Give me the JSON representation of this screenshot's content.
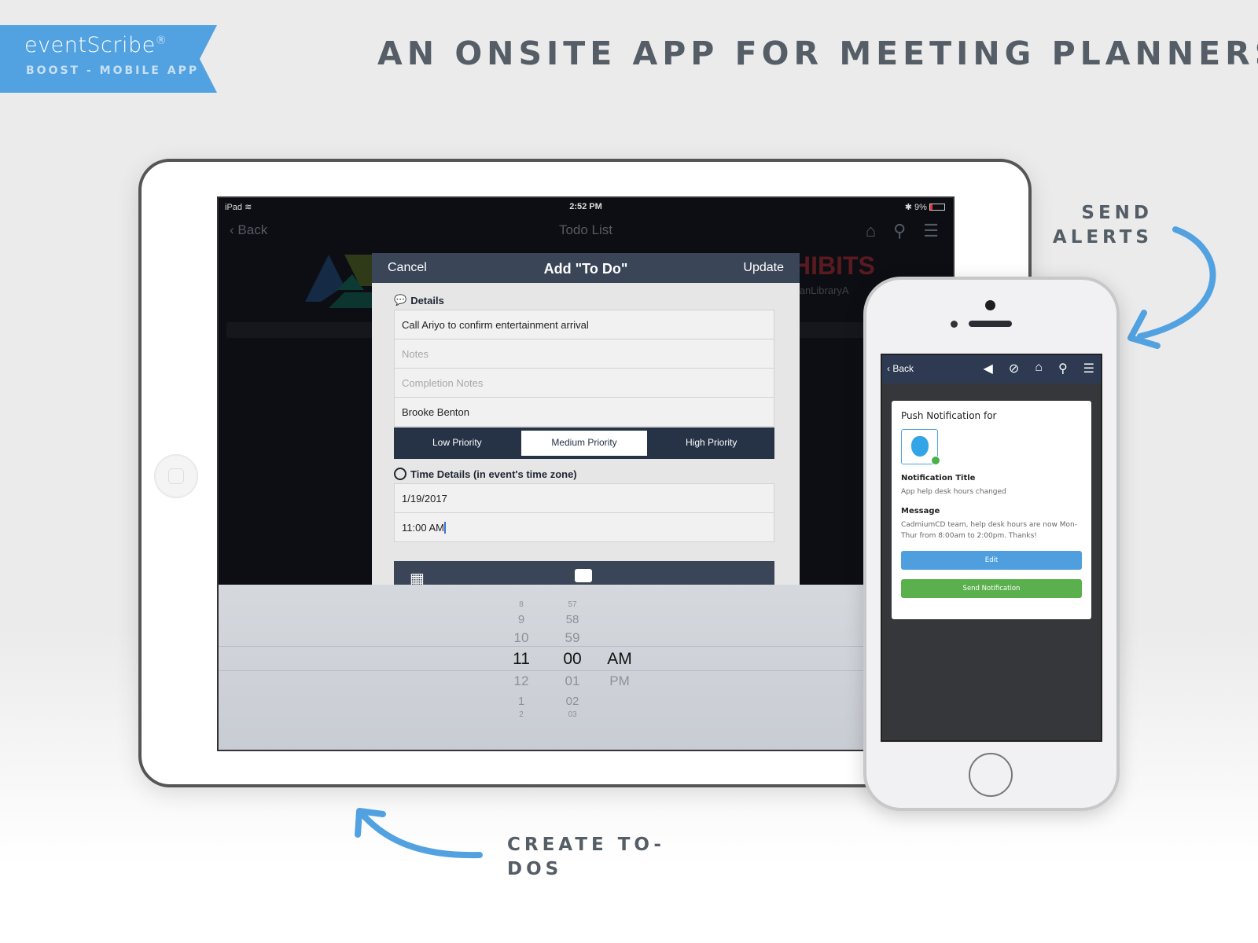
{
  "banner": {
    "brand": "eventScribe",
    "reg": "®",
    "subtitle": "BOOST - MOBILE APP"
  },
  "headline": "AN ONSITE APP FOR MEETING PLANNERS!",
  "callouts": {
    "send_alerts_line1": "SEND",
    "send_alerts_line2": "ALERTS",
    "create_todos": "CREATE TO-DOS"
  },
  "colors": {
    "accent_blue": "#52a2e1",
    "nav_dark": "#3a4558",
    "green": "#5ab04c",
    "headline_gray": "#555d66"
  },
  "ipad": {
    "status": {
      "device": "iPad",
      "wifi_icon": "wifi-icon",
      "time": "2:52 PM",
      "battery": "9%",
      "bluetooth_icon": "bluetooth-icon"
    },
    "nav": {
      "back": "Back",
      "title": "Todo List",
      "icons": [
        "home-icon",
        "search-icon",
        "menu-icon"
      ]
    },
    "background": {
      "banner_text": "HIBITS",
      "banner_sub": "ricanLibraryA"
    },
    "modal": {
      "cancel": "Cancel",
      "title": "Add \"To Do\"",
      "update": "Update",
      "details_label": "Details",
      "task": "Call Ariyo to confirm entertainment arrival",
      "notes_placeholder": "Notes",
      "completion_placeholder": "Completion Notes",
      "assignee": "Brooke Benton",
      "priorities": [
        "Low Priority",
        "Medium Priority",
        "High Priority"
      ],
      "selected_priority": "Medium Priority",
      "time_label": "Time Details (in event's time zone)",
      "date": "1/19/2017",
      "time": "11:00 AM",
      "toolbar_icons": [
        "qr-code-icon",
        "camera-icon"
      ]
    },
    "picker": {
      "hours": [
        "8",
        "9",
        "10",
        "11",
        "12",
        "1",
        "2"
      ],
      "minutes": [
        "57",
        "58",
        "59",
        "00",
        "01",
        "02",
        "03"
      ],
      "ampm": [
        "AM",
        "PM"
      ],
      "selected": {
        "hour": "11",
        "minute": "00",
        "ampm": "AM"
      }
    }
  },
  "iphone": {
    "nav": {
      "back": "Back",
      "icons": [
        "prev-arrow-icon",
        "compass-icon",
        "home-icon",
        "search-icon",
        "menu-icon"
      ]
    },
    "card": {
      "heading": "Push Notification for",
      "platform_icon": "apple-icon",
      "title_label": "Notification Title",
      "title_value": "App help desk hours changed",
      "message_label": "Message",
      "message_value": "CadmiumCD team, help desk hours are now Mon-Thur from 8:00am to 2:00pm. Thanks!",
      "edit_button": "Edit",
      "send_button": "Send Notification"
    }
  }
}
